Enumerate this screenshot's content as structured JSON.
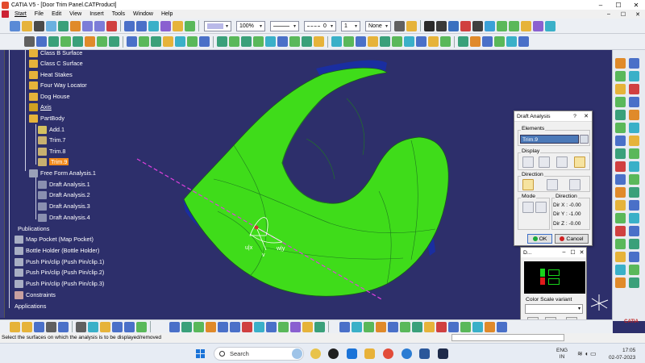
{
  "window": {
    "title": "CATIA V5 - [Door Trim Panel.CATProduct]",
    "controls": [
      "–",
      "☐",
      "✕"
    ]
  },
  "menu": {
    "items": [
      "Start",
      "File",
      "Edit",
      "View",
      "Insert",
      "Tools",
      "Window",
      "Help"
    ],
    "right_controls": [
      "–",
      "☐",
      "✕"
    ]
  },
  "toolbar": {
    "zoom_value": "100%",
    "line_value": "0",
    "layer_value": "None",
    "count_value": "1"
  },
  "tree": {
    "items": [
      {
        "label": "Class B Surface",
        "icon": "surface-icon"
      },
      {
        "label": "Class C Surface",
        "icon": "surface-icon"
      },
      {
        "label": "Heat Stakes",
        "icon": "gear-icon"
      },
      {
        "label": "Four Way Locator",
        "icon": "gear-icon"
      },
      {
        "label": "Dog House",
        "icon": "gear-icon"
      },
      {
        "label": "Axis",
        "icon": "axis-icon"
      },
      {
        "label": "PartBody",
        "icon": "gear-icon"
      },
      {
        "label": "Add.1",
        "icon": "add-icon"
      },
      {
        "label": "Trim.7",
        "icon": "trim-icon"
      },
      {
        "label": "Trim.8",
        "icon": "trim-icon"
      },
      {
        "label": "Trim.9",
        "icon": "trim-icon"
      },
      {
        "label": "Free Form Analysis.1",
        "icon": "analysis-icon"
      },
      {
        "label": "Draft Analysis.1",
        "icon": "draft-analysis-icon"
      },
      {
        "label": "Draft Analysis.2",
        "icon": "draft-analysis-icon"
      },
      {
        "label": "Draft Analysis.3",
        "icon": "draft-analysis-icon"
      },
      {
        "label": "Draft Analysis.4",
        "icon": "draft-analysis-icon"
      },
      {
        "label": "Publications",
        "icon": "publication-icon"
      },
      {
        "label": "Map Pocket (Map Pocket)",
        "icon": "part-icon"
      },
      {
        "label": "Bottle Holder (Bottle Holder)",
        "icon": "part-icon"
      },
      {
        "label": "Push Pin/clip (Push Pin/clip.1)",
        "icon": "part-icon"
      },
      {
        "label": "Push Pin/clip (Push Pin/clip.2)",
        "icon": "part-icon"
      },
      {
        "label": "Push Pin/clip (Push Pin/clip.3)",
        "icon": "part-icon"
      },
      {
        "label": "Constraints",
        "icon": "constraint-icon"
      },
      {
        "label": "Applications",
        "icon": "application-icon"
      }
    ]
  },
  "viewport": {
    "axis_labels": [
      "u|x",
      "v",
      "w|y"
    ]
  },
  "draft_dialog": {
    "title": "Draft Analysis",
    "help": "?",
    "close": "✕",
    "elements_label": "Elements",
    "elements_value": "Trim.9",
    "display_label": "Display",
    "direction_label": "Direction",
    "mode_label": "Mode",
    "direction_box_label": "Direction",
    "dir_x": "Dir X : -0.00",
    "dir_y": "Dir Y : -1.00",
    "dir_z": "Dir Z : -0.00",
    "ok": "OK",
    "cancel": "Cancel"
  },
  "color_dialog": {
    "title": "D...",
    "variant_label": "Color Scale variant",
    "colors": {
      "green": "#18d41a",
      "red": "#e01a1a"
    }
  },
  "status": {
    "message": "Select the surfaces on which the analysis is to be displayed/removed",
    "logo": "CATIA"
  },
  "taskbar": {
    "search": "Search",
    "lang": "ENG",
    "region": "IN",
    "time": "17:05",
    "date": "02-07-2023"
  },
  "colors": {
    "background": "#2d2f6b",
    "selection": "#f28a1b",
    "model_green": "#3fdc1a",
    "model_blue": "#1a2ea0"
  }
}
